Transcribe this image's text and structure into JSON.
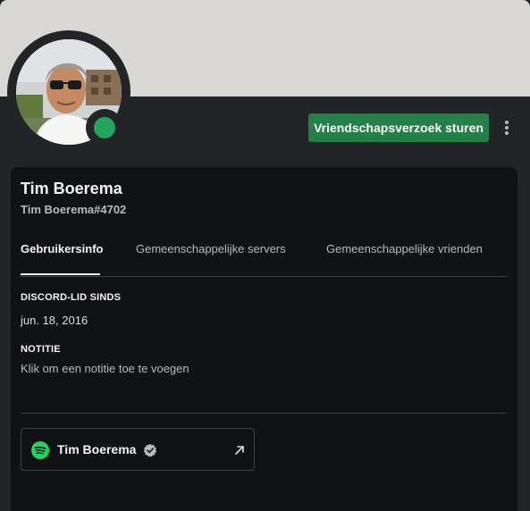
{
  "profile": {
    "display_name": "Tim Boerema",
    "username": "Tim Boerema#4702",
    "status": "online",
    "status_color": "#23a55a"
  },
  "actions": {
    "friend_request_label": "Vriendschapsverzoek sturen",
    "more_icon": "more-vertical-icon"
  },
  "tabs": [
    {
      "label": "Gebruikersinfo",
      "active": true
    },
    {
      "label": "Gemeenschappelijke servers",
      "active": false
    },
    {
      "label": "Gemeenschappelijke vrienden",
      "active": false
    }
  ],
  "member_since": {
    "heading": "DISCORD-LID SINDS",
    "date": "jun. 18, 2016"
  },
  "note": {
    "heading": "NOTITIE",
    "placeholder": "Klik om een notitie toe te voegen"
  },
  "connection": {
    "service_icon": "spotify-icon",
    "name": "Tim Boerema",
    "verified_icon": "verified-icon",
    "link_icon": "external-link-icon"
  },
  "colors": {
    "banner": "#d8d7d4",
    "background": "#232428",
    "card": "#111214",
    "button": "#248046",
    "spotify": "#1ed760"
  }
}
